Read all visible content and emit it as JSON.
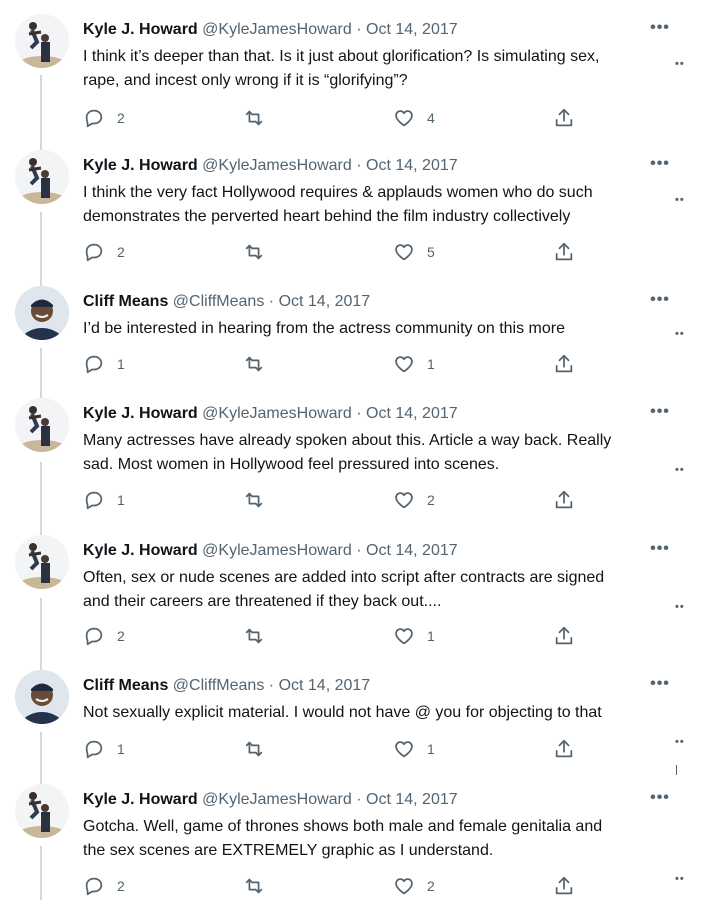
{
  "tweets": [
    {
      "name": "Kyle J. Howard",
      "handle": "@KyleJamesHoward",
      "date": "Oct 14, 2017",
      "text": "I think it’s deeper than that. Is it just about glorification? Is simulating sex,\nrape, and incest only wrong if it is “glorifying”?",
      "replies": "2",
      "retweets": "",
      "likes": "4"
    },
    {
      "name": "Kyle J. Howard",
      "handle": "@KyleJamesHoward",
      "date": "Oct 14, 2017",
      "text": "I think the very fact Hollywood requires & applauds women who do such\ndemonstrates the perverted heart behind the film industry collectively",
      "replies": "2",
      "retweets": "",
      "likes": "5"
    },
    {
      "name": "Cliff Means",
      "handle": "@CliffMeans",
      "date": "Oct 14, 2017",
      "text": "I’d be interested in hearing from the actress community on this more",
      "replies": "1",
      "retweets": "",
      "likes": "1"
    },
    {
      "name": "Kyle J. Howard",
      "handle": "@KyleJamesHoward",
      "date": "Oct 14, 2017",
      "text": "Many actresses have already spoken about this. Article a way back. Really\nsad. Most women in Hollywood feel pressured into scenes.",
      "replies": "1",
      "retweets": "",
      "likes": "2"
    },
    {
      "name": "Kyle J. Howard",
      "handle": "@KyleJamesHoward",
      "date": "Oct 14, 2017",
      "text": "Often, sex or nude scenes are added into script after contracts are signed\nand their careers are threatened if they back out....",
      "replies": "2",
      "retweets": "",
      "likes": "1"
    },
    {
      "name": "Cliff Means",
      "handle": "@CliffMeans",
      "date": "Oct 14, 2017",
      "text": "Not sexually explicit material. I would not have @ you for objecting to that",
      "replies": "1",
      "retweets": "",
      "likes": "1"
    },
    {
      "name": "Kyle J. Howard",
      "handle": "@KyleJamesHoward",
      "date": "Oct 14, 2017",
      "text": "Gotcha. Well, game of thrones shows both male and female genitalia and\nthe sex scenes are EXTREMELY graphic as I understand.",
      "replies": "2",
      "retweets": "",
      "likes": "2"
    }
  ],
  "ui": {
    "separator": "·",
    "more": "•••",
    "side_dots": "••"
  },
  "icons": {
    "reply": "reply-icon",
    "retweet": "retweet-icon",
    "like": "heart-icon",
    "share": "share-icon",
    "more": "more-icon"
  },
  "colors": {
    "text": "#0f1419",
    "secondary": "#536471",
    "thread": "#cfd9de"
  }
}
